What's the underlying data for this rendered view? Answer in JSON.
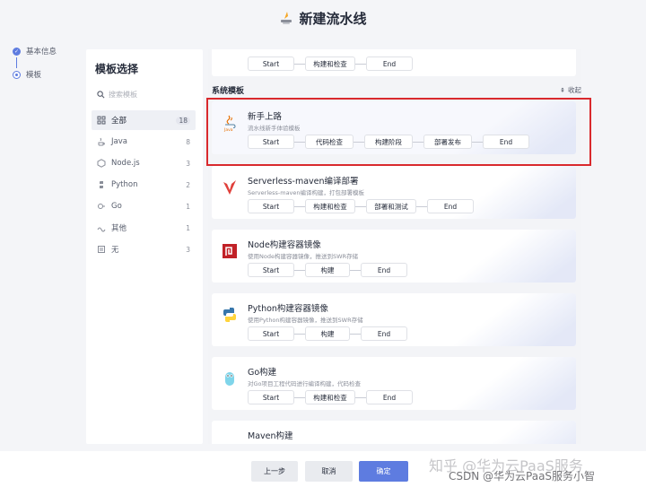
{
  "title": "新建流水线",
  "steps": [
    {
      "label": "基本信息",
      "state": "done"
    },
    {
      "label": "模板",
      "state": "current"
    }
  ],
  "sidebar": {
    "title": "模板选择",
    "search_placeholder": "搜索模板",
    "categories": [
      {
        "name": "全部",
        "count": "18",
        "icon": "grid-icon"
      },
      {
        "name": "Java",
        "count": "8",
        "icon": "java-icon"
      },
      {
        "name": "Node.js",
        "count": "3",
        "icon": "nodejs-icon"
      },
      {
        "name": "Python",
        "count": "2",
        "icon": "python-icon"
      },
      {
        "name": "Go",
        "count": "1",
        "icon": "go-icon"
      },
      {
        "name": "其他",
        "count": "1",
        "icon": "other-icon"
      },
      {
        "name": "无",
        "count": "3",
        "icon": "none-icon"
      }
    ]
  },
  "main": {
    "top_card_stages": [
      "Start",
      "构建和检查",
      "End"
    ],
    "section_title": "系统模板",
    "collapse_label": "收起",
    "templates": [
      {
        "name": "新手上路",
        "desc": "流水线新手体验模板",
        "stages": [
          "Start",
          "代码检查",
          "构建阶段",
          "部署发布",
          "End"
        ],
        "icon": "java-icon"
      },
      {
        "name": "Serverless-maven编译部署",
        "desc": "Serverless-maven编译构建，打包部署模板",
        "stages": [
          "Start",
          "构建和检查",
          "部署和测试",
          "End"
        ],
        "icon": "serverless-icon"
      },
      {
        "name": "Node构建容器镜像",
        "desc": "使用Node构建容器镜像，推送到SWR存储",
        "stages": [
          "Start",
          "构建",
          "End"
        ],
        "icon": "nodejs-icon"
      },
      {
        "name": "Python构建容器镜像",
        "desc": "使用Python构建容器镜像，推送到SWR存储",
        "stages": [
          "Start",
          "构建",
          "End"
        ],
        "icon": "python-icon"
      },
      {
        "name": "Go构建",
        "desc": "对Go项目工程代码进行编译构建，代码检查",
        "stages": [
          "Start",
          "构建和检查",
          "End"
        ],
        "icon": "go-icon"
      },
      {
        "name": "Maven构建",
        "desc": "",
        "stages": [],
        "icon": "maven-icon"
      }
    ]
  },
  "footer": {
    "prev_label": "上一步",
    "cancel_label": "取消",
    "ok_label": "确定"
  },
  "watermark": {
    "line1": "知乎 @华为云PaaS服务",
    "line2": "CSDN @华为云PaaS服务小智"
  },
  "colors": {
    "accent": "#5e7ce0",
    "highlight_border": "#d9292d"
  }
}
